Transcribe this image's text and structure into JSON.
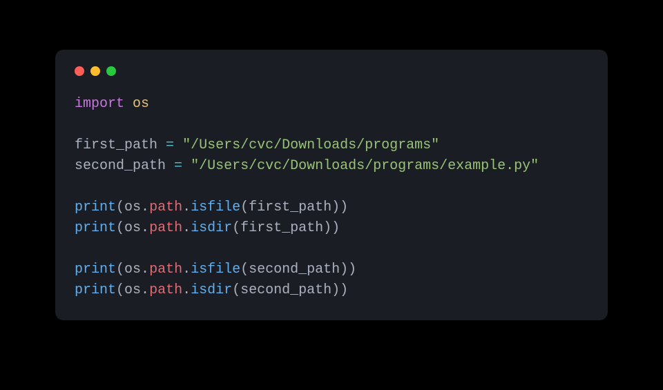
{
  "colors": {
    "bg_outer": "#000000",
    "bg_window": "#1a1d23",
    "traffic_red": "#ff5f57",
    "traffic_yellow": "#febc2e",
    "traffic_green": "#28c840",
    "keyword": "#c678dd",
    "module": "#e5c07b",
    "ident": "#abb2bf",
    "operator": "#56b6c2",
    "string": "#98c379",
    "function": "#61afef",
    "attribute": "#e06c75",
    "punct": "#abb2bf"
  },
  "code": {
    "lines": [
      [
        {
          "cls": "keyword",
          "text": "import"
        },
        {
          "cls": "ident",
          "text": " "
        },
        {
          "cls": "module",
          "text": "os"
        }
      ],
      [],
      [
        {
          "cls": "ident",
          "text": "first_path "
        },
        {
          "cls": "op",
          "text": "="
        },
        {
          "cls": "ident",
          "text": " "
        },
        {
          "cls": "string",
          "text": "\"/Users/cvc/Downloads/programs\""
        }
      ],
      [
        {
          "cls": "ident",
          "text": "second_path "
        },
        {
          "cls": "op",
          "text": "="
        },
        {
          "cls": "ident",
          "text": " "
        },
        {
          "cls": "string",
          "text": "\"/Users/cvc/Downloads/programs/example.py\""
        }
      ],
      [],
      [
        {
          "cls": "func",
          "text": "print"
        },
        {
          "cls": "punct",
          "text": "("
        },
        {
          "cls": "ident",
          "text": "os"
        },
        {
          "cls": "punct",
          "text": "."
        },
        {
          "cls": "attr",
          "text": "path"
        },
        {
          "cls": "punct",
          "text": "."
        },
        {
          "cls": "func",
          "text": "isfile"
        },
        {
          "cls": "punct",
          "text": "("
        },
        {
          "cls": "ident",
          "text": "first_path"
        },
        {
          "cls": "punct",
          "text": "))"
        }
      ],
      [
        {
          "cls": "func",
          "text": "print"
        },
        {
          "cls": "punct",
          "text": "("
        },
        {
          "cls": "ident",
          "text": "os"
        },
        {
          "cls": "punct",
          "text": "."
        },
        {
          "cls": "attr",
          "text": "path"
        },
        {
          "cls": "punct",
          "text": "."
        },
        {
          "cls": "func",
          "text": "isdir"
        },
        {
          "cls": "punct",
          "text": "("
        },
        {
          "cls": "ident",
          "text": "first_path"
        },
        {
          "cls": "punct",
          "text": "))"
        }
      ],
      [],
      [
        {
          "cls": "func",
          "text": "print"
        },
        {
          "cls": "punct",
          "text": "("
        },
        {
          "cls": "ident",
          "text": "os"
        },
        {
          "cls": "punct",
          "text": "."
        },
        {
          "cls": "attr",
          "text": "path"
        },
        {
          "cls": "punct",
          "text": "."
        },
        {
          "cls": "func",
          "text": "isfile"
        },
        {
          "cls": "punct",
          "text": "("
        },
        {
          "cls": "ident",
          "text": "second_path"
        },
        {
          "cls": "punct",
          "text": "))"
        }
      ],
      [
        {
          "cls": "func",
          "text": "print"
        },
        {
          "cls": "punct",
          "text": "("
        },
        {
          "cls": "ident",
          "text": "os"
        },
        {
          "cls": "punct",
          "text": "."
        },
        {
          "cls": "attr",
          "text": "path"
        },
        {
          "cls": "punct",
          "text": "."
        },
        {
          "cls": "func",
          "text": "isdir"
        },
        {
          "cls": "punct",
          "text": "("
        },
        {
          "cls": "ident",
          "text": "second_path"
        },
        {
          "cls": "punct",
          "text": "))"
        }
      ]
    ]
  }
}
